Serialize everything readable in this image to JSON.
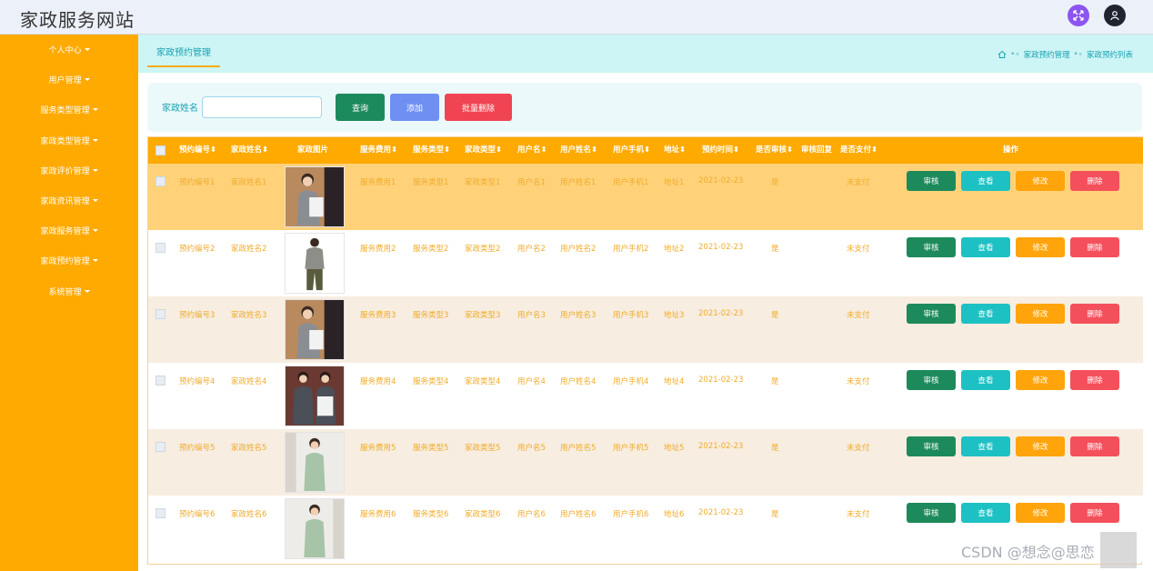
{
  "app": {
    "title": "家政服务网站"
  },
  "sidebar": {
    "items": [
      {
        "label": "个人中心"
      },
      {
        "label": "用户管理"
      },
      {
        "label": "服务类型管理"
      },
      {
        "label": "家政类型管理"
      },
      {
        "label": "家政评价管理"
      },
      {
        "label": "家政资讯管理"
      },
      {
        "label": "家政服务管理"
      },
      {
        "label": "家政预约管理"
      },
      {
        "label": "系统管理"
      }
    ]
  },
  "tab": {
    "label": "家政预约管理"
  },
  "breadcrumb": {
    "items": [
      "家政预约管理",
      "家政预约列表"
    ]
  },
  "search": {
    "label": "家政姓名",
    "value": "",
    "placeholder": ""
  },
  "buttons": {
    "query": "查询",
    "add": "添加",
    "batch_delete": "批量删除"
  },
  "table": {
    "headers": [
      "预约编号",
      "家政姓名",
      "家政图片",
      "服务费用",
      "服务类型",
      "家政类型",
      "用户名",
      "用户姓名",
      "用户手机",
      "地址",
      "预约时间",
      "是否审核",
      "审核回复",
      "是否支付",
      "操作"
    ],
    "action_labels": {
      "audit": "审核",
      "view": "查看",
      "edit": "修改",
      "delete": "删除"
    },
    "rows": [
      {
        "order_no": "预约编号1",
        "name": "家政姓名1",
        "fee": "服务费用1",
        "service_type": "服务类型1",
        "house_type": "家政类型1",
        "username": "用户名1",
        "user_name": "用户姓名1",
        "phone": "用户手机1",
        "address": "地址1",
        "time": "2021-02-23",
        "audited": "是",
        "reply": "",
        "paid": "未支付"
      },
      {
        "order_no": "预约编号2",
        "name": "家政姓名2",
        "fee": "服务费用2",
        "service_type": "服务类型2",
        "house_type": "家政类型2",
        "username": "用户名2",
        "user_name": "用户姓名2",
        "phone": "用户手机2",
        "address": "地址2",
        "time": "2021-02-23",
        "audited": "是",
        "reply": "",
        "paid": "未支付"
      },
      {
        "order_no": "预约编号3",
        "name": "家政姓名3",
        "fee": "服务费用3",
        "service_type": "服务类型3",
        "house_type": "家政类型3",
        "username": "用户名3",
        "user_name": "用户姓名3",
        "phone": "用户手机3",
        "address": "地址3",
        "time": "2021-02-23",
        "audited": "是",
        "reply": "",
        "paid": "未支付"
      },
      {
        "order_no": "预约编号4",
        "name": "家政姓名4",
        "fee": "服务费用4",
        "service_type": "服务类型4",
        "house_type": "家政类型4",
        "username": "用户名4",
        "user_name": "用户姓名4",
        "phone": "用户手机4",
        "address": "地址4",
        "time": "2021-02-23",
        "audited": "是",
        "reply": "",
        "paid": "未支付"
      },
      {
        "order_no": "预约编号5",
        "name": "家政姓名5",
        "fee": "服务费用5",
        "service_type": "服务类型5",
        "house_type": "家政类型5",
        "username": "用户名5",
        "user_name": "用户姓名5",
        "phone": "用户手机5",
        "address": "地址5",
        "time": "2021-02-23",
        "audited": "是",
        "reply": "",
        "paid": "未支付"
      },
      {
        "order_no": "预约编号6",
        "name": "家政姓名6",
        "fee": "服务费用6",
        "service_type": "服务类型6",
        "house_type": "家政类型6",
        "username": "用户名6",
        "user_name": "用户姓名6",
        "phone": "用户手机6",
        "address": "地址6",
        "time": "2021-02-23",
        "audited": "是",
        "reply": "",
        "paid": "未支付"
      }
    ]
  },
  "watermark": "CSDN @想念@思恋",
  "colors": {
    "sidebar": "#ffaa00",
    "header_row": "#ffaa00",
    "row_highlight": "#ffd27a",
    "row_alt": "#f7ede0",
    "tabbar": "#cdf5f5",
    "accent_text": "#17a3b3"
  }
}
